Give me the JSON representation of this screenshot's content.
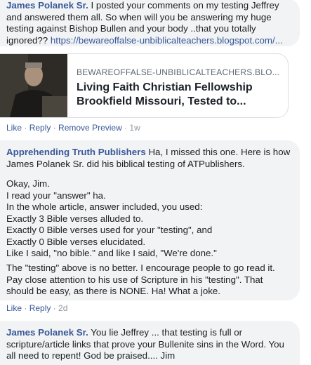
{
  "comment1": {
    "author": "James Polanek Sr.",
    "text": "I posted your comments on my testing Jeffrey and answered them all. So when will you be answering my huge testing against Bishop Bullen and your body ..that you totally ignored??",
    "link": "https://bewareoffalse-unbiblicalteachers.blogspot.com/..."
  },
  "preview": {
    "site": "BEWAREOFFALSE-UNBIBLICALTEACHERS.BLO...",
    "title": "Living Faith Christian Fellowship Brookfield Missouri, Tested to..."
  },
  "actions1": {
    "like": "Like",
    "reply": "Reply",
    "remove_preview": "Remove Preview",
    "time": "1w"
  },
  "comment2": {
    "author": "Apprehending Truth Publishers",
    "intro": "Ha, I missed this one. Here is how James Polanek Sr. did his biblical testing of ATPublishers.",
    "quote": "Okay, Jim.\nI read your \"answer\" ha.\nIn the whole article, answer included, you used:\nExactly 3 Bible verses alluded to.\nExactly 0 Bible verses used for your \"testing\", and\nExactly 0 Bible verses elucidated.\nLike I said, \"no bible.\" and like I said, \"We're done.\"",
    "outro": "The \"testing\" above is no better. I encourage people to go read it. Pay close attention to his use of Scripture in his \"testing\". That should be easy, as there is NONE. Ha! What a joke."
  },
  "actions2": {
    "like": "Like",
    "reply": "Reply",
    "time": "2d"
  },
  "comment3": {
    "author": "James Polanek Sr.",
    "text": "You lie Jeffrey ... that testing is full or scripture/article links that prove your Bullenite sins in the Word. You all need to repent! God be praised.... Jim"
  }
}
